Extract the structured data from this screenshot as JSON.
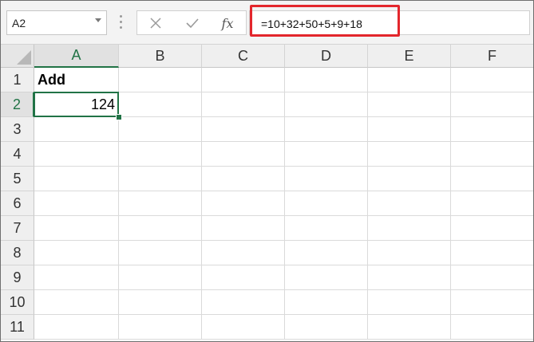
{
  "name_box": {
    "value": "A2"
  },
  "formula_bar": {
    "cancel_icon": "close-icon",
    "enter_icon": "check-icon",
    "fx_label": "fx",
    "formula": "=10+32+50+5+9+18"
  },
  "columns": [
    "A",
    "B",
    "C",
    "D",
    "E",
    "F"
  ],
  "rows": [
    "1",
    "2",
    "3",
    "4",
    "5",
    "6",
    "7",
    "8",
    "9",
    "10",
    "11"
  ],
  "cells": {
    "A1": "Add",
    "A2": "124"
  },
  "selection": {
    "active_cell": "A2"
  },
  "colors": {
    "selection_green": "#217346",
    "highlight_red": "#e3262c"
  }
}
